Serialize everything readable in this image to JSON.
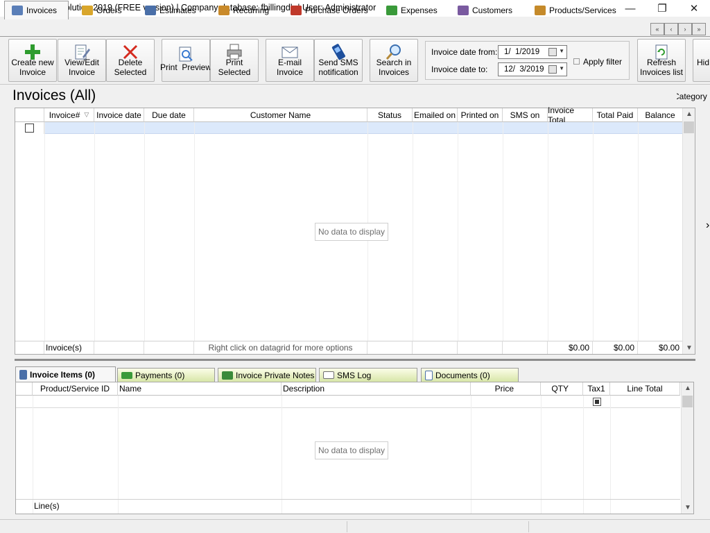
{
  "window": {
    "title": "F-Billing Revolution 2019 (FREE version) | Company database: fbillingdb | User: Administrator",
    "minimize": "—",
    "restore": "❐",
    "close": "✕"
  },
  "tabs": [
    {
      "label": "Invoices",
      "icon": "invoice-icon",
      "color": "#5b7fb8"
    },
    {
      "label": "Orders",
      "icon": "orders-icon",
      "color": "#d9a62b"
    },
    {
      "label": "Estimates",
      "icon": "estimates-icon",
      "color": "#4a6fa8"
    },
    {
      "label": "Recurring",
      "icon": "recurring-icon",
      "color": "#c98a2a"
    },
    {
      "label": "Purchase Orders",
      "icon": "truck-icon",
      "color": "#c0392b"
    },
    {
      "label": "Expenses",
      "icon": "money-icon",
      "color": "#3a9a3a"
    },
    {
      "label": "Customers",
      "icon": "customers-icon",
      "color": "#7a5aa0"
    },
    {
      "label": "Products/Services",
      "icon": "products-icon",
      "color": "#c58a2a"
    }
  ],
  "nav": {
    "first": "«",
    "prev": "‹",
    "next": "›",
    "last": "»"
  },
  "toolbar": {
    "create": [
      "Create new",
      "Invoice"
    ],
    "view_edit": [
      "View/Edit",
      "Invoice"
    ],
    "delete": [
      "Delete",
      "Selected"
    ],
    "print_preview": [
      "Print  Preview"
    ],
    "print_selected": [
      "Print",
      "Selected"
    ],
    "email": [
      "E-mail",
      "Invoice"
    ],
    "sms": [
      "Send SMS",
      "notification"
    ],
    "search": [
      "Search in",
      "Invoices"
    ],
    "refresh": [
      "Refresh",
      "Invoices list"
    ],
    "hide": "Hid"
  },
  "filter": {
    "from_label": "Invoice date from:",
    "from_value": "1/  1/2019",
    "to_label": "Invoice date to:",
    "to_value": "12/  3/2019",
    "apply_label": "Apply filter"
  },
  "heading": "Invoices (All)",
  "category_label": "Category",
  "grid": {
    "columns": [
      "Invoice#",
      "Invoice date",
      "Due date",
      "Customer Name",
      "Status",
      "Emailed on",
      "Printed on",
      "SMS on",
      "Invoice Total",
      "Total Paid",
      "Balance"
    ],
    "empty_text": "No data to display",
    "footer_count": "Invoice(s)",
    "footer_hint": "Right click on datagrid for more options",
    "footer_total": "$0.00",
    "footer_paid": "$0.00",
    "footer_balance": "$0.00"
  },
  "bottom_tabs": [
    {
      "label": "Invoice Items (0)",
      "icon": "items-icon",
      "color": "#4a6fa8"
    },
    {
      "label": "Payments (0)",
      "icon": "money-icon",
      "color": "#3a9a3a"
    },
    {
      "label": "Invoice Private Notes",
      "icon": "notes-icon",
      "color": "#3a8a3a"
    },
    {
      "label": "SMS Log",
      "icon": "sms-icon",
      "color": "#6f6f6f"
    },
    {
      "label": "Documents (0)",
      "icon": "document-icon",
      "color": "#4a6fa8"
    }
  ],
  "items_grid": {
    "columns": [
      "Product/Service ID",
      "Name",
      "Description",
      "Price",
      "QTY",
      "Tax1",
      "Line Total"
    ],
    "empty_text": "No data to display",
    "footer_count": "Line(s)"
  }
}
